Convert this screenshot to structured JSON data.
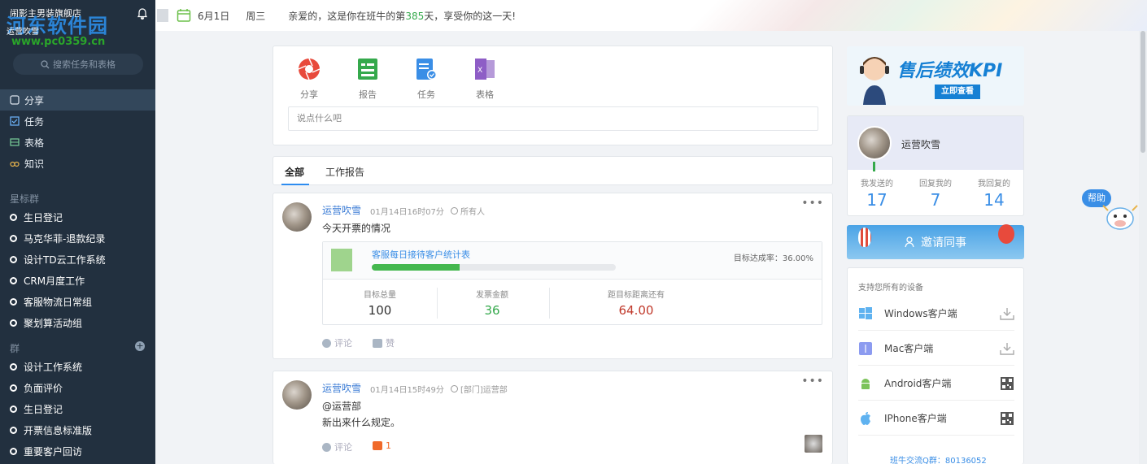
{
  "sidebar": {
    "store_name": "闹影主男装旗舰店",
    "user_short": "运营吹雪",
    "watermark": "河东软件园",
    "watermark_url": "www.pc0359.cn",
    "search_placeholder": "搜索任务和表格",
    "nav": [
      {
        "label": "分享",
        "icon": "share-icon"
      },
      {
        "label": "任务",
        "icon": "task-icon"
      },
      {
        "label": "表格",
        "icon": "table-icon"
      },
      {
        "label": "知识",
        "icon": "knowledge-icon"
      }
    ],
    "starred_title": "星标群",
    "starred": [
      "生日登记",
      "马克华菲-退款纪录",
      "设计TD云工作系统",
      "CRM月度工作",
      "客服物流日常组",
      "聚划算活动组"
    ],
    "groups_title": "群",
    "groups": [
      "设计工作系统",
      "负面评价",
      "生日登记",
      "开票信息标准版",
      "重要客户回访"
    ]
  },
  "topbar": {
    "date": "6月1日",
    "weekday": "周三",
    "greeting_pre": "亲爱的，这是你在班牛的第",
    "days": "385",
    "greeting_post": "天，享受你的这一天!"
  },
  "composer": {
    "buttons": [
      {
        "label": "分享",
        "color": "#e84a3c"
      },
      {
        "label": "报告",
        "color": "#35a94c"
      },
      {
        "label": "任务",
        "color": "#3a8ee6"
      },
      {
        "label": "表格",
        "color": "#8e5dc6"
      }
    ],
    "placeholder": "说点什么吧"
  },
  "tabs": [
    "全部",
    "工作报告"
  ],
  "feed": [
    {
      "user": "运营吹雪",
      "time": "01月14日16时07分",
      "visibility": "所有人",
      "text": "今天开票的情况",
      "sheet": {
        "name": "客服每日接待客户统计表",
        "rate_label": "目标达成率：36.00%",
        "progress": 0.36,
        "stats": [
          {
            "label": "目标总量",
            "value": "100",
            "color": "#333333"
          },
          {
            "label": "发票金额",
            "value": "36",
            "color": "#35a94c"
          },
          {
            "label": "距目标距离还有",
            "value": "64.00",
            "color": "#c0392b"
          }
        ]
      },
      "comment": "评论",
      "like": "赞"
    },
    {
      "user": "运营吹雪",
      "time": "01月14日15时49分",
      "visibility": "[部门]运营部",
      "mention": "@运营部",
      "text": "新出来什么规定。",
      "comment": "评论",
      "like_count": "1"
    }
  ],
  "banner": {
    "title": "售后绩效KPI",
    "button": "立即查看"
  },
  "profile": {
    "name": "运营吹雪",
    "stats": [
      {
        "label": "我发送的",
        "value": "17"
      },
      {
        "label": "回复我的",
        "value": "7"
      },
      {
        "label": "我回复的",
        "value": "14"
      }
    ]
  },
  "invite": "邀请同事",
  "devices": {
    "title": "支持您所有的设备",
    "items": [
      {
        "name": "Windows客户端",
        "icon": "windows-icon",
        "action": "download-icon"
      },
      {
        "name": "Mac客户端",
        "icon": "mac-icon",
        "action": "download-icon"
      },
      {
        "name": "Android客户端",
        "icon": "android-icon",
        "action": "qrcode-icon"
      },
      {
        "name": "IPhone客户端",
        "icon": "apple-icon",
        "action": "qrcode-icon"
      }
    ],
    "footer": "班牛交流Q群：80136052"
  },
  "help": "帮助"
}
